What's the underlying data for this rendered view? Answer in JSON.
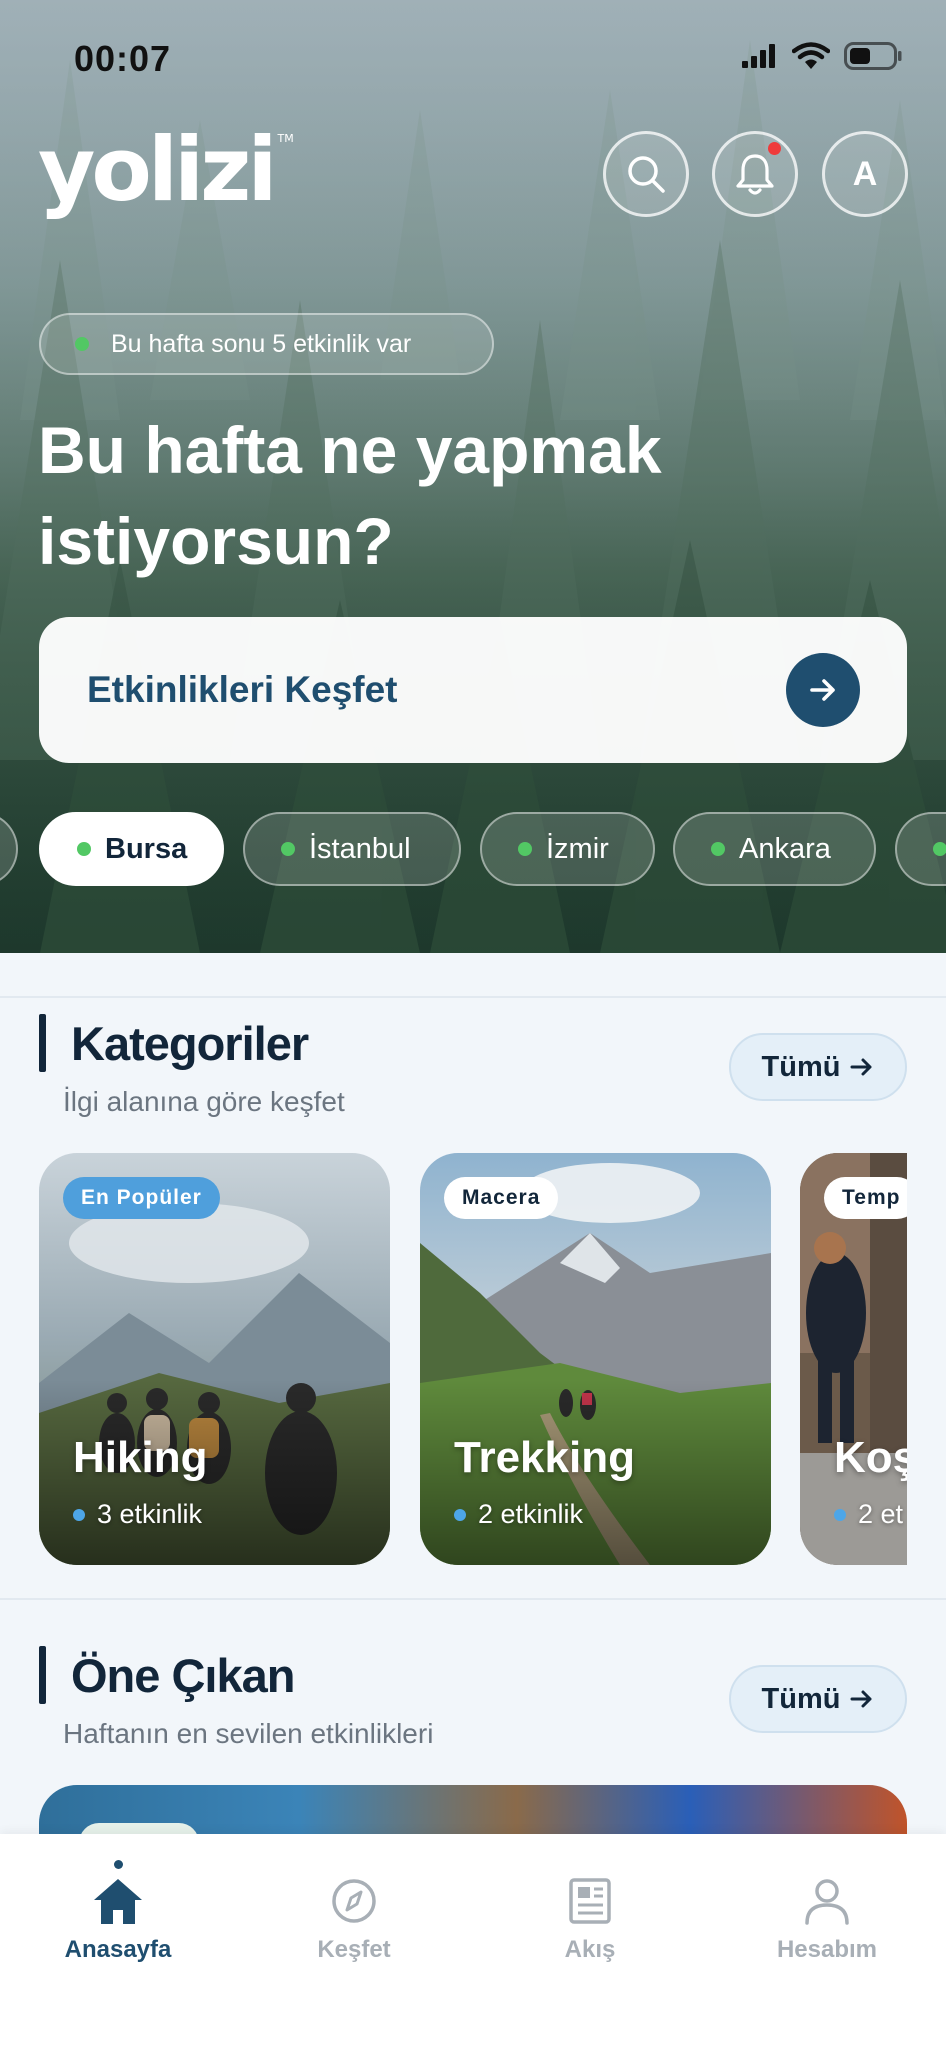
{
  "status_bar": {
    "time": "00:07"
  },
  "header": {
    "logo": "yolizi",
    "logo_mark": "TM",
    "avatar_letter": "A"
  },
  "hero": {
    "event_note": "Bu hafta sonu 5 etkinlik var",
    "title": "Bu hafta ne yapmak istiyorsun?",
    "cta_label": "Etkinlikleri Keşfet"
  },
  "cities": [
    {
      "label": "Bursa",
      "selected": true
    },
    {
      "label": "İstanbul",
      "selected": false
    },
    {
      "label": "İzmir",
      "selected": false
    },
    {
      "label": "Ankara",
      "selected": false
    }
  ],
  "categories_section": {
    "title": "Kategoriler",
    "subtitle": "İlgi alanına göre keşfet",
    "all_label": "Tümü",
    "cards": [
      {
        "badge": "En Popüler",
        "name": "Hiking",
        "count": "3 etkinlik"
      },
      {
        "badge": "Macera",
        "name": "Trekking",
        "count": "2 etkinlik"
      },
      {
        "badge": "Temp",
        "name": "Koş",
        "count": "2 et"
      }
    ]
  },
  "featured_section": {
    "title": "Öne Çıkan",
    "subtitle": "Haftanın en sevilen etkinlikleri",
    "all_label": "Tümü"
  },
  "bottom_nav": [
    {
      "label": "Anasayfa",
      "icon": "home-icon",
      "active": true
    },
    {
      "label": "Keşfet",
      "icon": "compass-icon",
      "active": false
    },
    {
      "label": "Akış",
      "icon": "newspaper-icon",
      "active": false
    },
    {
      "label": "Hesabım",
      "icon": "person-icon",
      "active": false
    }
  ],
  "colors": {
    "primary": "#1f4e6f",
    "navy_text": "#12263a",
    "online_green": "#52c864",
    "count_blue": "#4da6e8",
    "notification_red": "#ef3b3b",
    "badge_popular": "#4f9fdc"
  }
}
